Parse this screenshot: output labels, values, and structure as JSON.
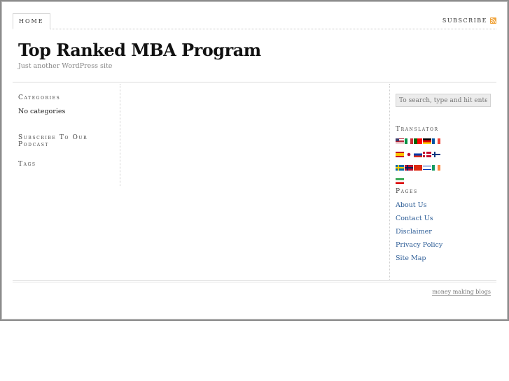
{
  "nav": {
    "home_label": "HOME",
    "subscribe_label": "SUBSCRIBE",
    "rss_icon": "rss-icon"
  },
  "header": {
    "title": "Top Ranked MBA Program",
    "tagline": "Just another WordPress site"
  },
  "left_sidebar": {
    "categories_title": "Categories",
    "categories_text": "No categories",
    "podcast_title": "Subscribe To Our Podcast",
    "tags_title": "Tags"
  },
  "right_sidebar": {
    "search_placeholder": "To search, type and hit enter",
    "translator_title": "Translator",
    "flags": [
      "us-flag-icon",
      "it-flag-icon",
      "pt-flag-icon",
      "de-flag-icon",
      "fr-flag-icon",
      "es-flag-icon",
      "jp-flag-icon",
      "ru-flag-icon",
      "dk-flag-icon",
      "fi-flag-icon",
      "se-flag-icon",
      "no-flag-icon",
      "cn-flag-icon",
      "il-flag-icon",
      "ie-flag-icon",
      "ir-flag-icon"
    ],
    "pages_title": "Pages",
    "pages": [
      "About Us",
      "Contact Us",
      "Disclaimer",
      "Privacy Policy",
      "Site Map"
    ]
  },
  "footer": {
    "link": "money making blogs"
  },
  "colors": {
    "link": "#2e5e97",
    "rss": "#f0a53e"
  }
}
